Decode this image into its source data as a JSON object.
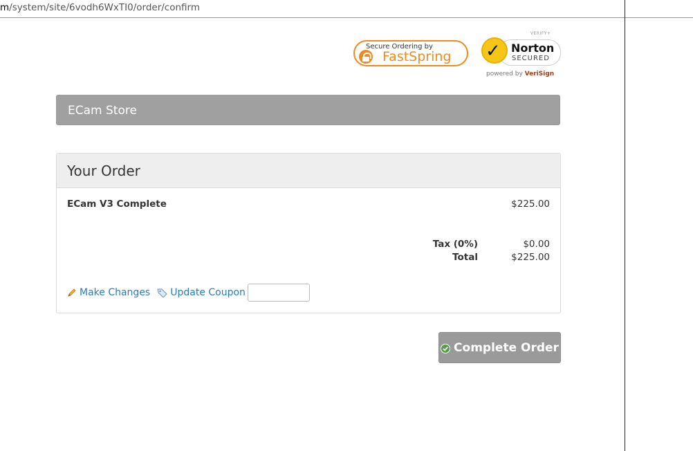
{
  "browser": {
    "url_prefix": "m",
    "url_rest": "/system/site/6vodh6WxTI0/order/confirm"
  },
  "badges": {
    "fastspring_small": "Secure Ordering by",
    "fastspring_name": "FastSpring",
    "norton_verify": "VERIFY+",
    "norton_name": "Norton",
    "norton_secured": "SECURED",
    "norton_powered_prefix": "powered by",
    "norton_powered_brand": "VeriSign"
  },
  "store": {
    "name": "ECam Store"
  },
  "order": {
    "title": "Your Order",
    "items": [
      {
        "name": "ECam V3 Complete",
        "price": "$225.00"
      }
    ],
    "tax_label": "Tax (0%)",
    "tax_value": "$0.00",
    "total_label": "Total",
    "total_value": "$225.00",
    "make_changes_label": "Make Changes",
    "update_coupon_label": "Update Coupon",
    "coupon_value": ""
  },
  "actions": {
    "complete_label": "Complete Order"
  },
  "colors": {
    "accent_link": "#2b7bb9",
    "fastspring_orange": "#f08a1c",
    "store_bar": "#a0a0a0",
    "button_gray": "#9a9a9a"
  }
}
